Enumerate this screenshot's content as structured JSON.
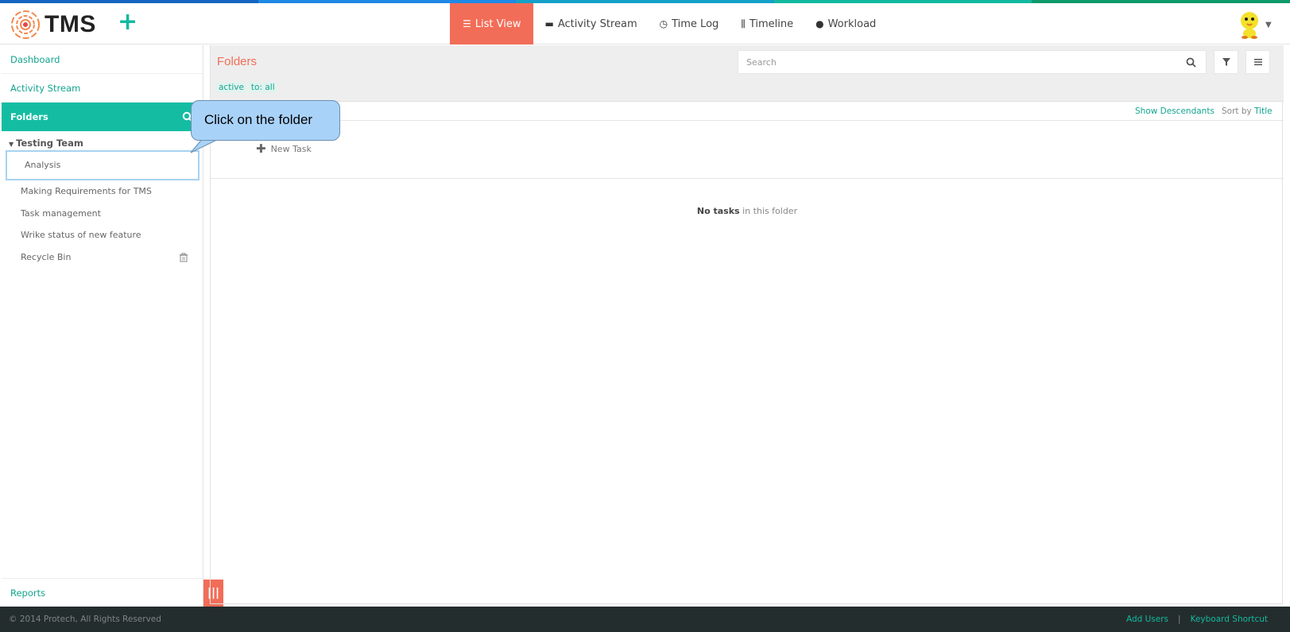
{
  "app": {
    "logo_text": "TMS",
    "add_button": "+"
  },
  "nav": [
    {
      "label": "List View",
      "icon": "list-icon",
      "glyph": "☰"
    },
    {
      "label": "Activity Stream",
      "icon": "comment-icon",
      "glyph": "▬"
    },
    {
      "label": "Time Log",
      "icon": "clock-icon",
      "glyph": "◷"
    },
    {
      "label": "Timeline",
      "icon": "timeline-icon",
      "glyph": "⫼"
    },
    {
      "label": "Workload",
      "icon": "user-icon",
      "glyph": "●"
    }
  ],
  "sidebar": {
    "dashboard": "Dashboard",
    "activity_stream": "Activity Stream",
    "folders": "Folders",
    "team": "Testing Team",
    "items": [
      {
        "label": "Analysis"
      },
      {
        "label": "Making Requirements for TMS"
      },
      {
        "label": "Task management"
      },
      {
        "label": "Wrike status of new feature"
      },
      {
        "label": "Recycle Bin"
      }
    ],
    "reports": "Reports",
    "collapse_glyph": "|||"
  },
  "main": {
    "title": "Folders",
    "filters": [
      "active",
      "to: all"
    ],
    "search_placeholder": "Search",
    "show_descendants": "Show Descendants",
    "sort_by_label": "Sort by",
    "sort_by_value": "Title",
    "new_task": "New Task",
    "empty_bold": "No tasks",
    "empty_rest": " in this folder"
  },
  "callout": {
    "text": "Click on the folder"
  },
  "footer": {
    "copyright": "© 2014 Protech, All Rights Reserved",
    "add_users": "Add Users",
    "separator": "|",
    "keyboard_shortcut": "Keyboard Shortcut"
  },
  "colors": {
    "accent": "#14bda2",
    "brand_orange": "#f26d58",
    "callout": "#a9d2f8",
    "footer": "#242d2d"
  }
}
